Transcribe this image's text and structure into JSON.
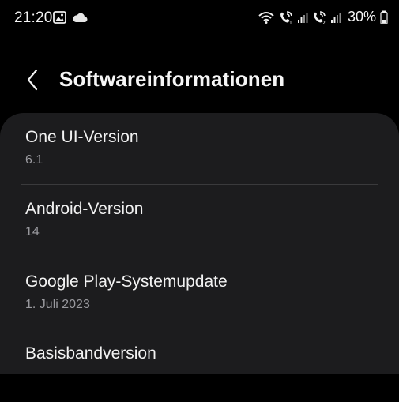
{
  "status_bar": {
    "time": "21:20",
    "left_icons": [
      "image-icon",
      "cloud-icon"
    ],
    "right_icons": [
      "wifi-calling-icon",
      "volte-sim1-icon",
      "signal-sim1-icon",
      "volte-sim2-icon",
      "signal-sim2-icon",
      "battery-icon"
    ],
    "battery_percent": "30%"
  },
  "header": {
    "title": "Softwareinformationen",
    "back_icon": "chevron-left-icon"
  },
  "items": [
    {
      "label": "One UI-Version",
      "value": "6.1"
    },
    {
      "label": "Android-Version",
      "value": "14"
    },
    {
      "label": "Google Play-Systemupdate",
      "value": "1. Juli 2023"
    },
    {
      "label": "Basisbandversion",
      "value": ""
    }
  ],
  "colors": {
    "background": "#000000",
    "card": "#1c1c1e",
    "primary_text": "#f2f2f2",
    "secondary_text": "#9a9a9f",
    "divider": "#3a3a3c"
  }
}
